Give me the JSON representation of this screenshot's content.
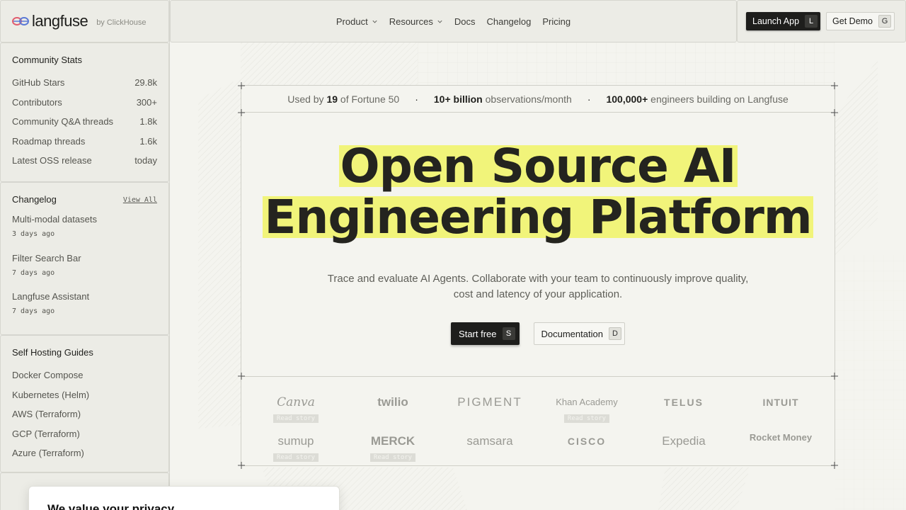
{
  "brand": {
    "name": "langfuse",
    "by": "by ClickHouse",
    "accent_color": "#f1f47a"
  },
  "community_stats": {
    "title": "Community Stats",
    "rows": [
      {
        "label": "GitHub Stars",
        "value": "29.8k"
      },
      {
        "label": "Contributors",
        "value": "300+"
      },
      {
        "label": "Community Q&A threads",
        "value": "1.8k"
      },
      {
        "label": "Roadmap threads",
        "value": "1.6k"
      },
      {
        "label": "Latest OSS release",
        "value": "today"
      }
    ]
  },
  "changelog": {
    "title": "Changelog",
    "view_all": "View All",
    "items": [
      {
        "title": "Multi-modal datasets",
        "date": "3 days ago"
      },
      {
        "title": "Filter Search Bar",
        "date": "7 days ago"
      },
      {
        "title": "Langfuse Assistant",
        "date": "7 days ago"
      }
    ]
  },
  "self_hosting": {
    "title": "Self Hosting Guides",
    "items": [
      "Docker Compose",
      "Kubernetes (Helm)",
      "AWS (Terraform)",
      "GCP (Terraform)",
      "Azure (Terraform)"
    ]
  },
  "nav": {
    "product": "Product",
    "resources": "Resources",
    "docs": "Docs",
    "changelog": "Changelog",
    "pricing": "Pricing"
  },
  "actions": {
    "launch_app": "Launch App",
    "launch_app_key": "L",
    "get_demo": "Get Demo",
    "get_demo_key": "G"
  },
  "stats_line": {
    "used_by_pre": "Used by",
    "used_by_num": "19",
    "used_by_post": "of Fortune 50",
    "observations_num": "10+ billion",
    "observations_post": "observations/month",
    "engineers_num": "100,000+",
    "engineers_post": "engineers building on Langfuse"
  },
  "hero": {
    "title_line1": "Open Source AI",
    "title_line2": "Engineering Platform",
    "subtitle": "Trace and evaluate AI Agents. Collaborate with your team to continuously improve quality, cost and latency of your application.",
    "cta_primary": "Start free",
    "cta_primary_key": "S",
    "cta_secondary": "Documentation",
    "cta_secondary_key": "D"
  },
  "customer_logos": {
    "read_story": "Read story",
    "row1": [
      "Canva",
      "twilio",
      "PIGMENT",
      "Khan Academy",
      "TELUS",
      "INTUIT"
    ],
    "row2": [
      "sumup",
      "MERCK",
      "samsara",
      "CISCO",
      "Expedia",
      "Rocket Money"
    ]
  },
  "cookie": {
    "title": "We value your privacy"
  }
}
